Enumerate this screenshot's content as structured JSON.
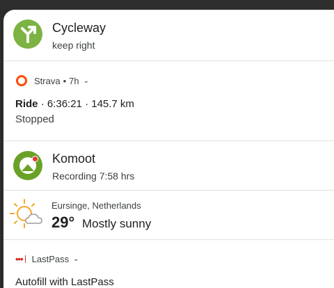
{
  "notifications": {
    "cycleway": {
      "title": "Cycleway",
      "subtitle": "keep right",
      "icon": "fork-right-arrow-icon",
      "color": "#7cb342"
    },
    "strava": {
      "app": "Strava",
      "time": "7h",
      "activity": "Ride",
      "stats": "· 6:36:21 · 145.7 km",
      "status": "Stopped",
      "color": "#fc4c02"
    },
    "komoot": {
      "title": "Komoot",
      "subtitle": "Recording 7:58 hrs",
      "color": "#6aa127"
    },
    "weather": {
      "location": "Eursinge, Netherlands",
      "temp": "29°",
      "condition": "Mostly sunny",
      "icon": "partly-sunny-icon"
    },
    "lastpass": {
      "app": "LastPass",
      "body": "Autofill with LastPass",
      "color": "#d32d27"
    }
  }
}
